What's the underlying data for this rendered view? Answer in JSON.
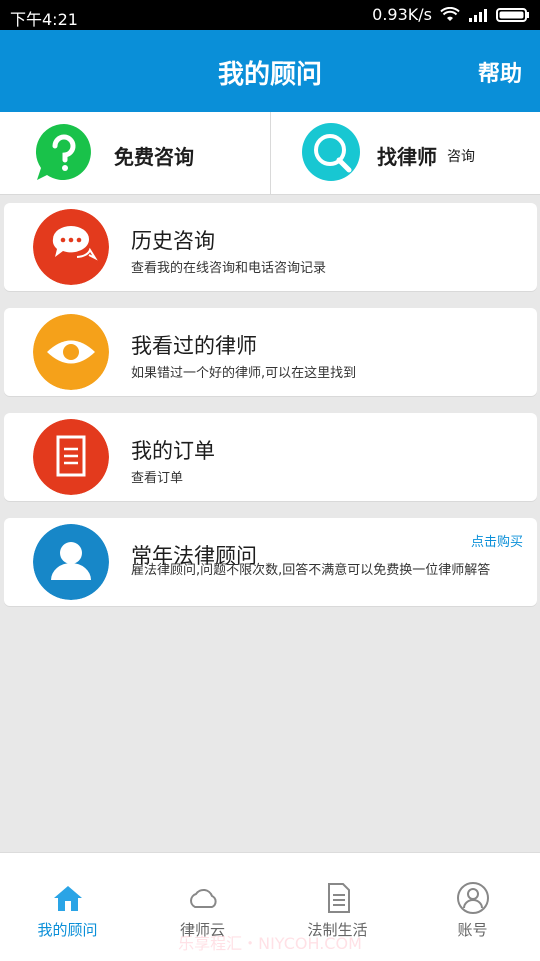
{
  "status_bar": {
    "time": "下午4:21",
    "speed": "0.93K/s",
    "icons": [
      "wifi-icon",
      "signal-icon",
      "battery-icon"
    ]
  },
  "header": {
    "title": "我的顾问",
    "help": "帮助"
  },
  "quick_actions": [
    {
      "label": "免费咨询",
      "sub": "",
      "icon": "question-bubble-icon",
      "color": "#19c24a"
    },
    {
      "label": "找律师",
      "sub": "咨询",
      "icon": "search-magnifier-icon",
      "color": "#18c7d2"
    }
  ],
  "cards": [
    {
      "title": "历史咨询",
      "sub": "查看我的在线咨询和电话咨询记录",
      "icon": "chat-bubble-icon",
      "color": "#e33a1d"
    },
    {
      "title": "我看过的律师",
      "sub": "如果错过一个好的律师,可以在这里找到",
      "icon": "eye-icon",
      "color": "#f5a11a"
    },
    {
      "title": "我的订单",
      "sub": "查看订单",
      "icon": "document-icon",
      "color": "#e33a1d"
    },
    {
      "title": "常年法律顾问",
      "sub": "雇法律顾问,问题不限次数,回答不满意可以免费换一位律师解答",
      "icon": "user-avatar-icon",
      "color": "#1787c8",
      "action": "点击购买"
    }
  ],
  "bottom_nav": [
    {
      "label": "我的顾问",
      "icon": "home-icon",
      "active": true
    },
    {
      "label": "律师云",
      "icon": "cloud-icon",
      "active": false
    },
    {
      "label": "法制生活",
      "icon": "document-icon",
      "active": false
    },
    {
      "label": "账号",
      "icon": "account-icon",
      "active": false
    }
  ],
  "watermark": "乐享程汇・NIYCOH.COM",
  "colors": {
    "brand": "#0a8fd8",
    "background": "#e8e8e8"
  }
}
